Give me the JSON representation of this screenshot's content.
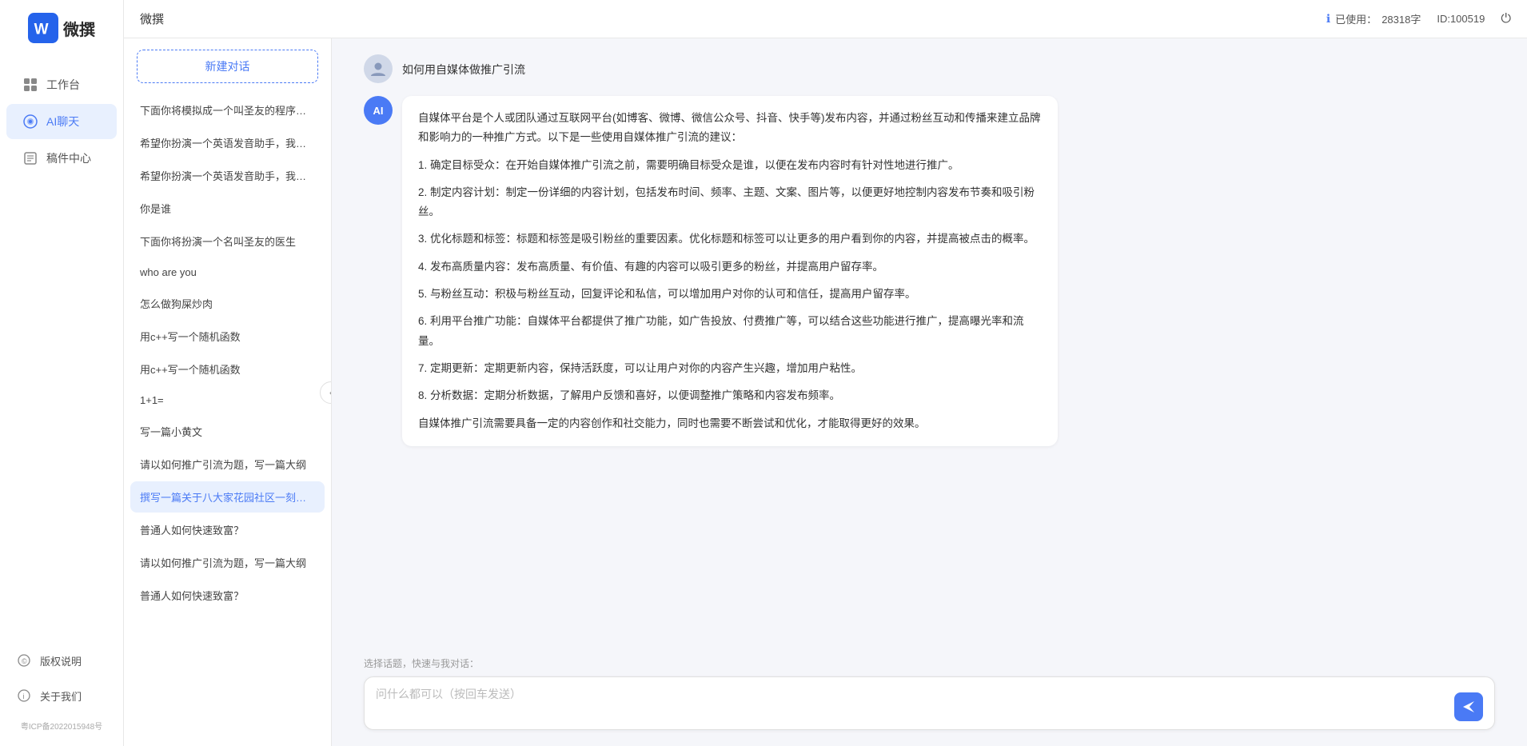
{
  "app": {
    "name": "微撰",
    "title": "微撰"
  },
  "header": {
    "title": "微撰",
    "usage_label": "已使用：",
    "usage_value": "28318字",
    "id_label": "ID:100519"
  },
  "sidebar": {
    "nav_items": [
      {
        "id": "workbench",
        "label": "工作台",
        "active": false
      },
      {
        "id": "ai-chat",
        "label": "AI聊天",
        "active": true
      },
      {
        "id": "drafts",
        "label": "稿件中心",
        "active": false
      }
    ],
    "bottom_items": [
      {
        "id": "copyright",
        "label": "版权说明"
      },
      {
        "id": "about",
        "label": "关于我们"
      }
    ],
    "icp": "粤ICP备2022015948号"
  },
  "conv_panel": {
    "new_btn_label": "新建对话",
    "conversations": [
      {
        "id": 1,
        "text": "下面你将模拟成一个叫圣友的程序员，我说...",
        "active": false
      },
      {
        "id": 2,
        "text": "希望你扮演一个英语发音助手，我提供给你...",
        "active": false
      },
      {
        "id": 3,
        "text": "希望你扮演一个英语发音助手，我提供给你...",
        "active": false
      },
      {
        "id": 4,
        "text": "你是谁",
        "active": false
      },
      {
        "id": 5,
        "text": "下面你将扮演一个名叫圣友的医生",
        "active": false
      },
      {
        "id": 6,
        "text": "who are you",
        "active": false
      },
      {
        "id": 7,
        "text": "怎么做狗屎炒肉",
        "active": false
      },
      {
        "id": 8,
        "text": "用c++写一个随机函数",
        "active": false
      },
      {
        "id": 9,
        "text": "用c++写一个随机函数",
        "active": false
      },
      {
        "id": 10,
        "text": "1+1=",
        "active": false
      },
      {
        "id": 11,
        "text": "写一篇小黄文",
        "active": false
      },
      {
        "id": 12,
        "text": "请以如何推广引流为题，写一篇大纲",
        "active": false
      },
      {
        "id": 13,
        "text": "撰写一篇关于八大家花园社区一刻钟便民生...",
        "active": true
      },
      {
        "id": 14,
        "text": "普通人如何快速致富？",
        "active": false
      },
      {
        "id": 15,
        "text": "请以如何推广引流为题，写一篇大纲",
        "active": false
      },
      {
        "id": 16,
        "text": "普通人如何快速致富？",
        "active": false
      }
    ]
  },
  "chat": {
    "user_question": "如何用自媒体做推广引流",
    "ai_response": {
      "paragraphs": [
        "自媒体平台是个人或团队通过互联网平台(如博客、微博、微信公众号、抖音、快手等)发布内容，并通过粉丝互动和传播来建立品牌和影响力的一种推广方式。以下是一些使用自媒体推广引流的建议：",
        "1. 确定目标受众：在开始自媒体推广引流之前，需要明确目标受众是谁，以便在发布内容时有针对性地进行推广。",
        "2. 制定内容计划：制定一份详细的内容计划，包括发布时间、频率、主题、文案、图片等，以便更好地控制内容发布节奏和吸引粉丝。",
        "3. 优化标题和标签：标题和标签是吸引粉丝的重要因素。优化标题和标签可以让更多的用户看到你的内容，并提高被点击的概率。",
        "4. 发布高质量内容：发布高质量、有价值、有趣的内容可以吸引更多的粉丝，并提高用户留存率。",
        "5. 与粉丝互动：积极与粉丝互动，回复评论和私信，可以增加用户对你的认可和信任，提高用户留存率。",
        "6. 利用平台推广功能：自媒体平台都提供了推广功能，如广告投放、付费推广等，可以结合这些功能进行推广，提高曝光率和流量。",
        "7. 定期更新：定期更新内容，保持活跃度，可以让用户对你的内容产生兴趣，增加用户粘性。",
        "8. 分析数据：定期分析数据，了解用户反馈和喜好，以便调整推广策略和内容发布频率。",
        "自媒体推广引流需要具备一定的内容创作和社交能力，同时也需要不断尝试和优化，才能取得更好的效果。"
      ]
    },
    "quick_select_label": "选择话题，快速与我对话：",
    "input_placeholder": "问什么都可以（按回车发送）"
  }
}
